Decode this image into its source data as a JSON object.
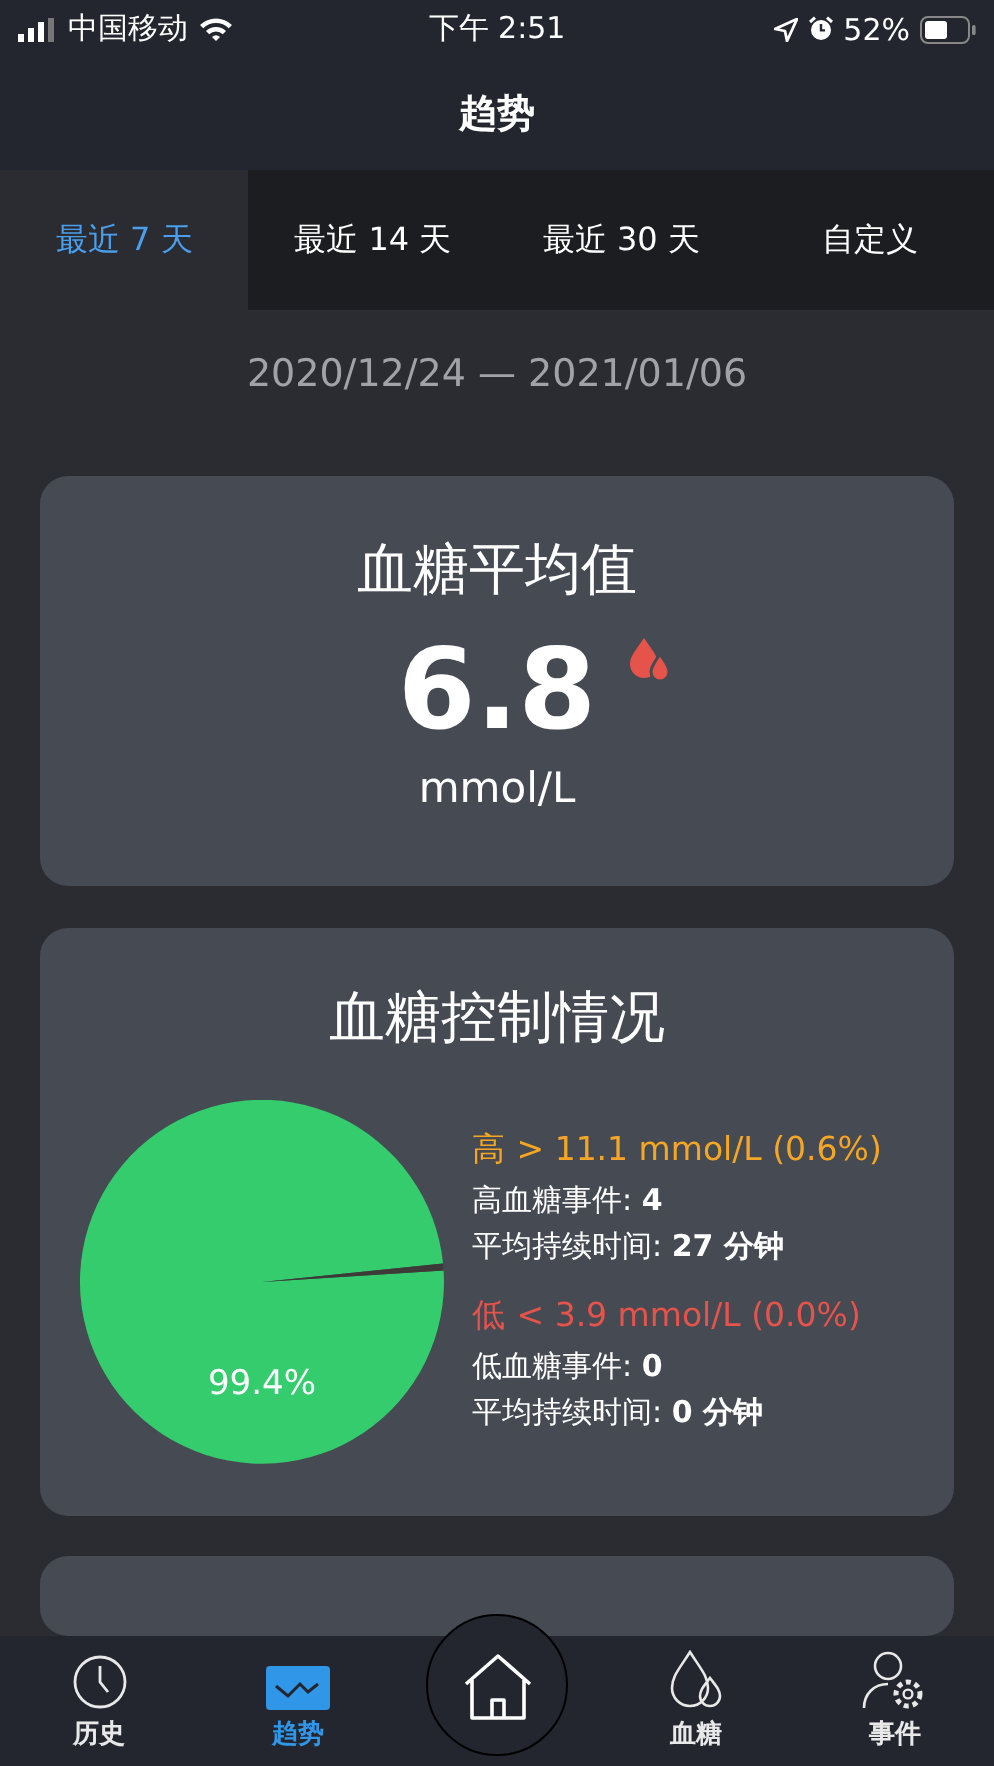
{
  "status_bar": {
    "carrier": "中国移动",
    "time": "下午 2:51",
    "battery": "52%"
  },
  "header": {
    "title": "趋势"
  },
  "tabs": [
    {
      "label": "最近 7 天",
      "selected": true
    },
    {
      "label": "最近 14 天",
      "selected": false
    },
    {
      "label": "最近 30 天",
      "selected": false
    },
    {
      "label": "自定义",
      "selected": false
    }
  ],
  "date_range": "2020/12/24 — 2021/01/06",
  "average_card": {
    "title": "血糖平均值",
    "value": "6.8",
    "unit": "mmol/L"
  },
  "control_card": {
    "title": "血糖控制情况",
    "chart_data": {
      "type": "pie",
      "values": [
        99.4,
        0.6,
        0.0
      ],
      "value_labels": [
        "99.4%",
        null,
        null
      ]
    },
    "ranges": [
      {
        "heading": "高 > 11.1 mmol/L (0.6%)",
        "color": "#f5a623",
        "lines": [
          "高血糖事件: **4**",
          "平均持续时间: **27 分钟**"
        ]
      },
      {
        "heading": "低 < 3.9 mmol/L (0.0%)",
        "color": "#e5534b",
        "lines": [
          "低血糖事件: **0**",
          "平均持续时间: **0 分钟**"
        ]
      }
    ]
  },
  "bottom_nav": [
    {
      "label": "历史",
      "selected": false
    },
    {
      "label": "趋势",
      "selected": true
    },
    {
      "label": "血糖",
      "selected": false
    },
    {
      "label": "事件",
      "selected": false
    }
  ]
}
